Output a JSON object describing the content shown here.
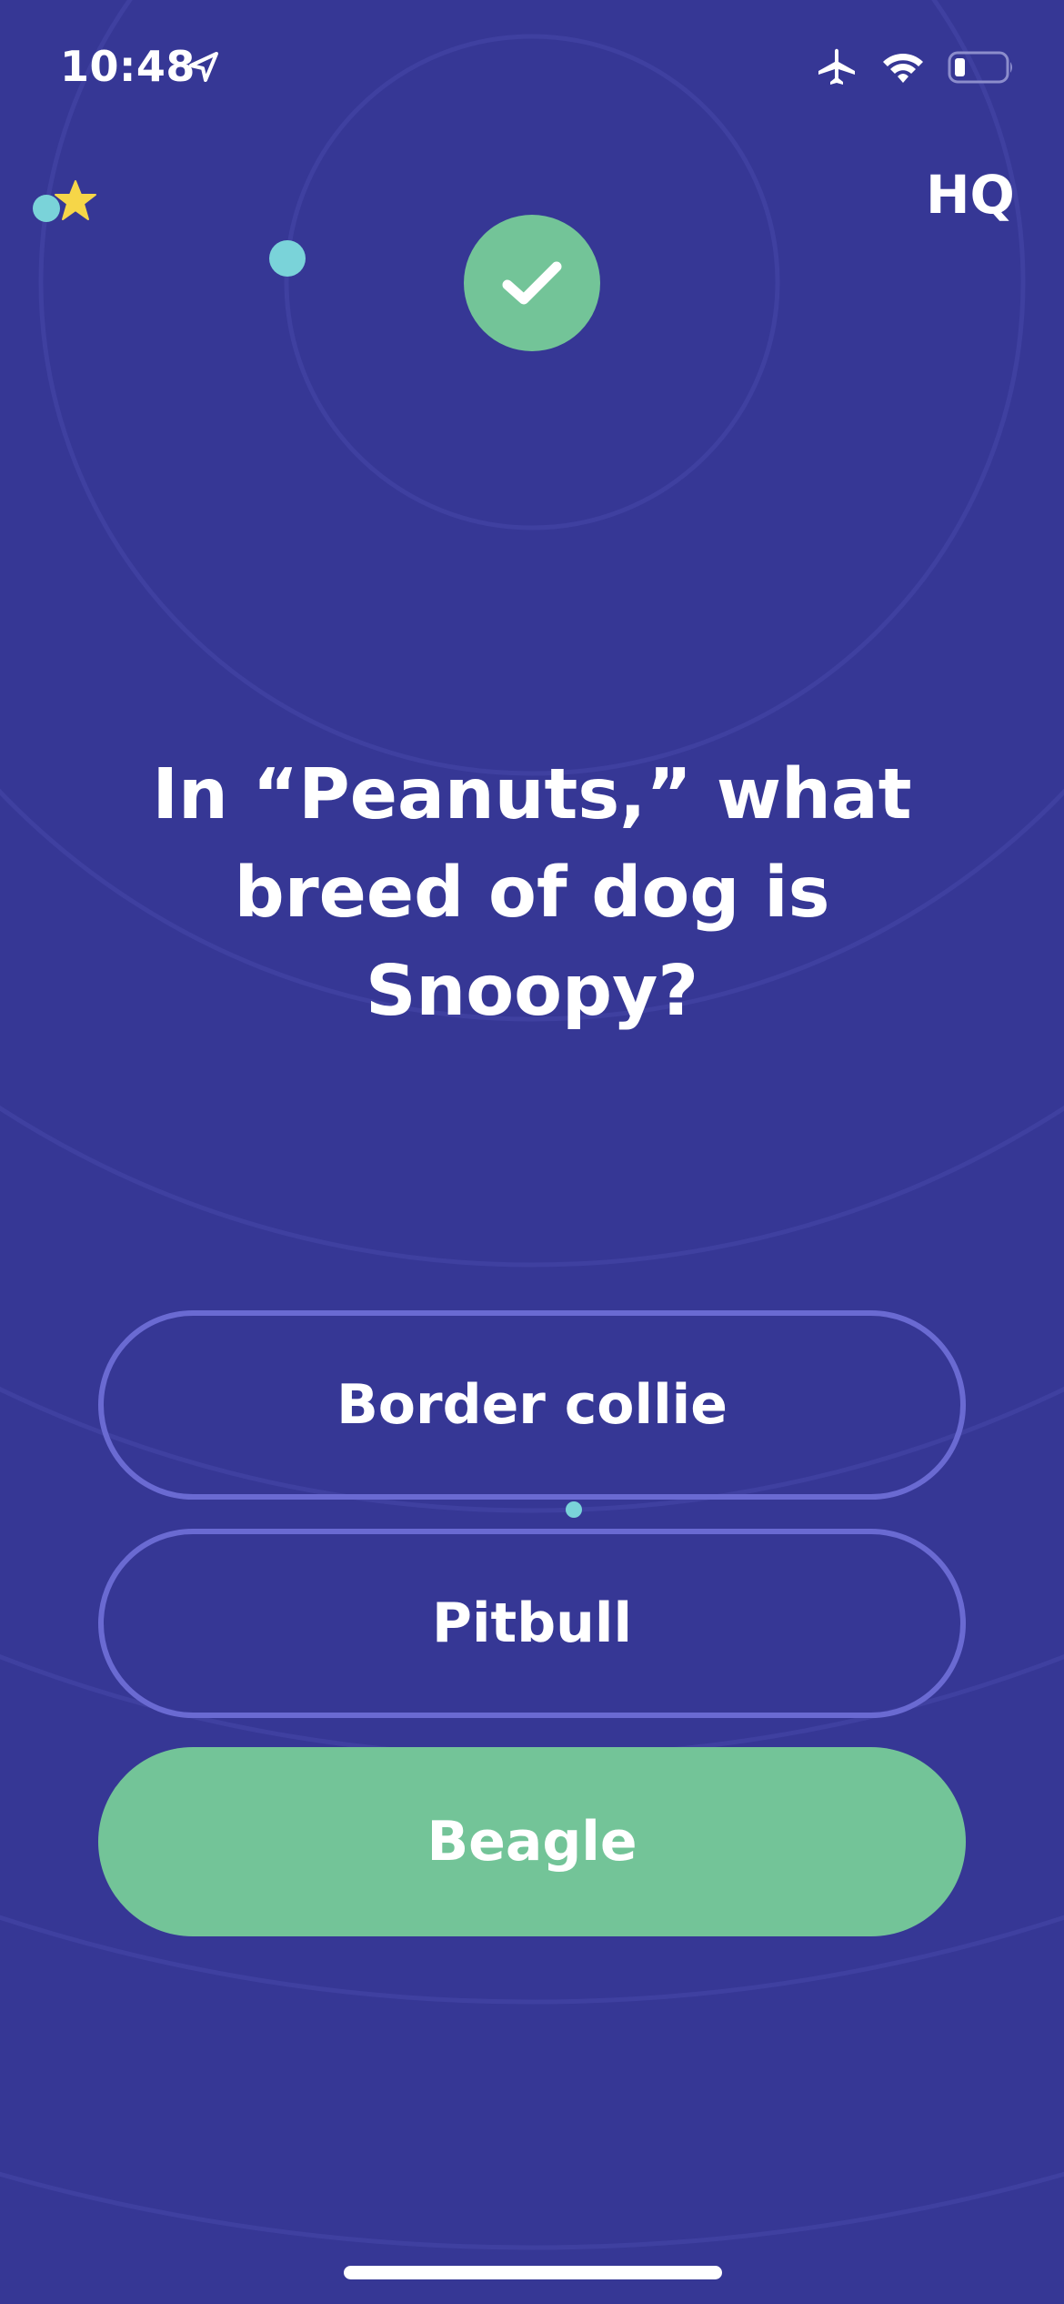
{
  "status_bar": {
    "time": "10:48",
    "location_icon": "location-arrow-icon",
    "airplane_icon": "airplane-icon",
    "wifi_icon": "wifi-icon",
    "battery_icon": "battery-low-icon"
  },
  "header": {
    "logo_text": "HQ",
    "star_icon": "star-icon",
    "result_icon": "checkmark-icon"
  },
  "question": {
    "text": "In “Peanuts,” what breed of dog is Snoopy?"
  },
  "answers": [
    {
      "label": "Border collie",
      "state": "unselected"
    },
    {
      "label": "Pitbull",
      "state": "unselected"
    },
    {
      "label": "Beagle",
      "state": "correct"
    }
  ],
  "colors": {
    "background": "#363795",
    "correct_green": "#73c498",
    "outline": "#6a6ad2",
    "accent_teal": "#7ad3d9",
    "star_yellow": "#f6d648"
  }
}
